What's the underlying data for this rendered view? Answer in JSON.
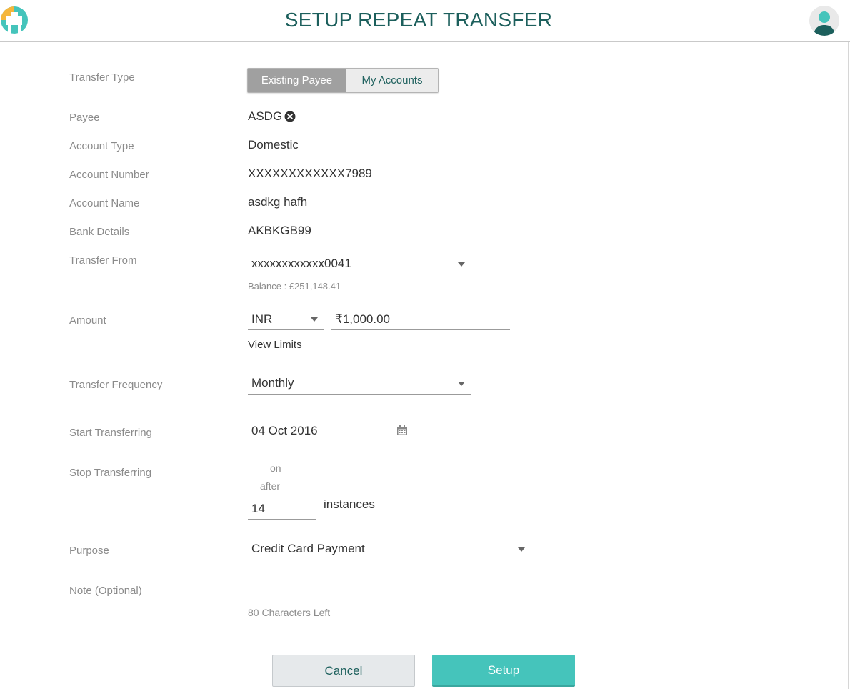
{
  "header": {
    "title": "SETUP REPEAT TRANSFER"
  },
  "labels": {
    "transfer_type": "Transfer Type",
    "payee": "Payee",
    "account_type": "Account Type",
    "account_number": "Account Number",
    "account_name": "Account Name",
    "bank_details": "Bank Details",
    "transfer_from": "Transfer From",
    "amount": "Amount",
    "transfer_frequency": "Transfer Frequency",
    "start_transferring": "Start Transferring",
    "stop_transferring": "Stop Transferring",
    "purpose": "Purpose",
    "note": "Note (Optional)"
  },
  "transfer_type": {
    "options": [
      "Existing Payee",
      "My Accounts"
    ],
    "selected": "Existing Payee"
  },
  "payee": {
    "name": "ASDG",
    "remove_icon": "close-circle-icon"
  },
  "account": {
    "type": "Domestic",
    "number": "XXXXXXXXXXXX7989",
    "name": "asdkg hafh",
    "bank": "AKBKGB99"
  },
  "transfer_from": {
    "value": "xxxxxxxxxxxx0041",
    "balance": "Balance : £251,148.41"
  },
  "amount": {
    "currency": "INR",
    "value": "₹1,000.00",
    "view_limits": "View Limits"
  },
  "frequency": {
    "value": "Monthly"
  },
  "start": {
    "date": "04 Oct 2016",
    "icon": "calendar-icon"
  },
  "stop": {
    "option_on": "on",
    "option_after": "after",
    "instances_value": "14",
    "instances_label": "instances"
  },
  "purpose": {
    "value": "Credit Card Payment"
  },
  "note": {
    "value": "",
    "chars_left": "80 Characters Left"
  },
  "buttons": {
    "cancel": "Cancel",
    "setup": "Setup"
  },
  "colors": {
    "brand": "#1c5f5c",
    "accent": "#45c4bb",
    "logo_yellow": "#f5b63b"
  }
}
